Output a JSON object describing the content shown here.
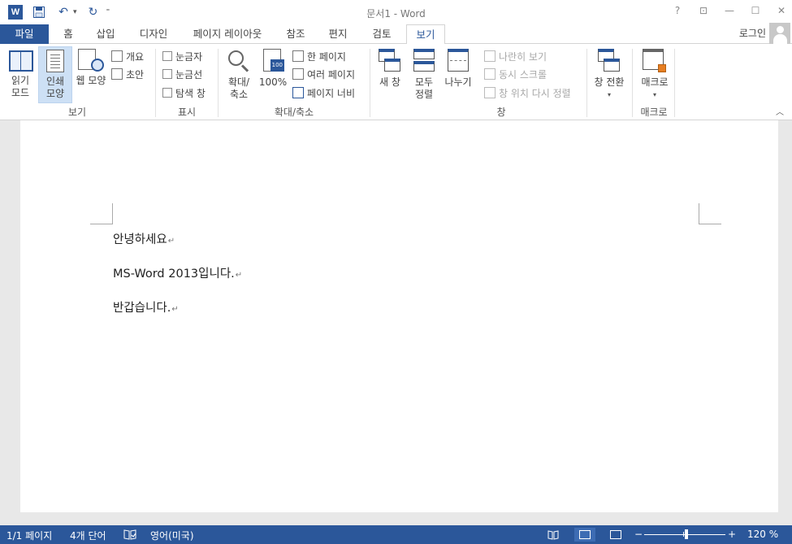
{
  "window": {
    "title": "문서1 - Word",
    "controls": [
      "?",
      "⊡",
      "—",
      "☐",
      "✕"
    ]
  },
  "qat": {
    "app_icon": "W",
    "undo_glyph": "↶",
    "redo_glyph": "↻",
    "customize_glyph": "⁼"
  },
  "tabs": {
    "file": "파일",
    "home": "홈",
    "insert": "삽입",
    "design": "디자인",
    "layout": "페이지 레이아웃",
    "references": "참조",
    "mailings": "편지",
    "review": "검토",
    "view": "보기"
  },
  "account": {
    "signin": "로그인"
  },
  "ribbon": {
    "views": {
      "label": "보기",
      "read_mode": [
        "읽기",
        "모드"
      ],
      "print_layout": [
        "인쇄",
        "모양"
      ],
      "web_layout": "웹 모양",
      "outline": "개요",
      "draft": "초안"
    },
    "show": {
      "label": "표시",
      "ruler": "눈금자",
      "gridlines": "눈금선",
      "nav_pane": "탐색 창"
    },
    "zoom": {
      "label": "확대/축소",
      "zoom": [
        "확대/",
        "축소"
      ],
      "hundred": "100%",
      "hundred_tag": "100",
      "one_page": "한 페이지",
      "multiple_pages": "여러 페이지",
      "page_width": "페이지 너비"
    },
    "window": {
      "label": "창",
      "new_window": "새 창",
      "arrange_all": [
        "모두",
        "정렬"
      ],
      "split": "나누기",
      "side_by_side": "나란히 보기",
      "sync_scroll": "동시 스크롤",
      "reset_position": "창 위치 다시 정렬",
      "switch_windows": "창 전환"
    },
    "macros": {
      "label": "매크로",
      "macros": "매크로"
    },
    "caret": "▾",
    "collapse": "︿"
  },
  "document": {
    "paragraphs": [
      "안녕하세요",
      "MS-Word 2013입니다.",
      "반갑습니다."
    ],
    "pilcrow": "↵"
  },
  "status": {
    "page": "1/1 페이지",
    "words": "4개 단어",
    "language": "영어(미국)",
    "zoom_minus": "−",
    "zoom_plus": "+",
    "zoom_level": "120 %",
    "zoom_percent_value": 120
  },
  "colors": {
    "accent": "#2b579a",
    "statusbar": "#2b579a",
    "selected": "#cde0f5"
  }
}
